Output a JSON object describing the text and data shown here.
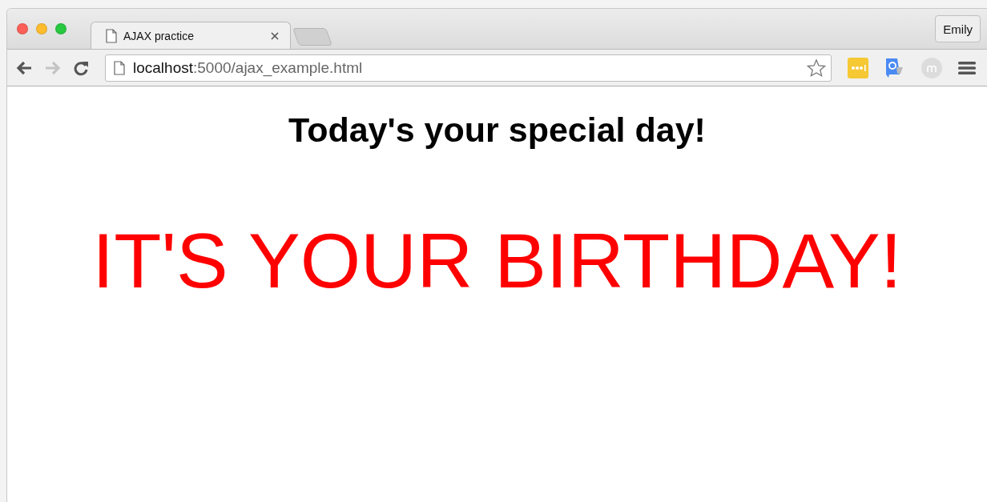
{
  "tabs": [
    {
      "title": "AJAX practice",
      "selected": true
    }
  ],
  "profile": {
    "name": "Emily"
  },
  "toolbar": {
    "forward_disabled": true
  },
  "address_bar": {
    "host": "localhost",
    "rest": ":5000/ajax_example.html"
  },
  "page": {
    "heading": "Today's your special day!",
    "message": "IT'S YOUR BIRTHDAY!"
  }
}
